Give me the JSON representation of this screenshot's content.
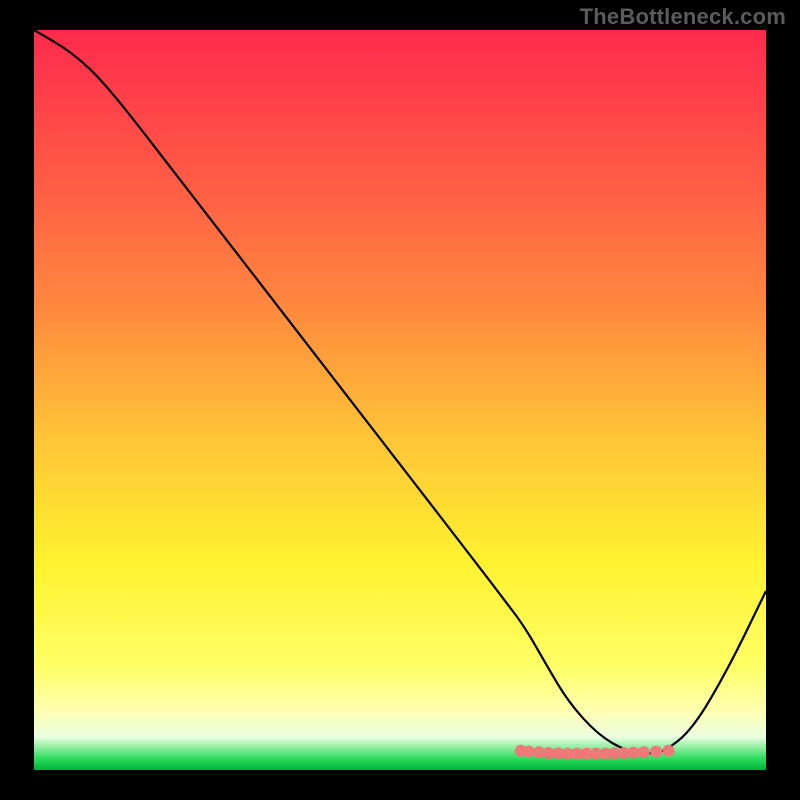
{
  "watermark": "TheBottleneck.com",
  "chart_data": {
    "type": "line",
    "title": "",
    "xlabel": "",
    "ylabel": "",
    "xlim": [
      0,
      100
    ],
    "ylim": [
      0,
      100
    ],
    "gradient_stops": [
      {
        "offset": 0.0,
        "color": "#ff2a4d"
      },
      {
        "offset": 0.2,
        "color": "#ff5a45"
      },
      {
        "offset": 0.38,
        "color": "#ff8a3e"
      },
      {
        "offset": 0.55,
        "color": "#ffc437"
      },
      {
        "offset": 0.72,
        "color": "#fff22f"
      },
      {
        "offset": 0.86,
        "color": "#ffff66"
      },
      {
        "offset": 0.92,
        "color": "#ffffb0"
      },
      {
        "offset": 0.955,
        "color": "#ecffe0"
      },
      {
        "offset": 0.985,
        "color": "#2bdc5d"
      },
      {
        "offset": 1.0,
        "color": "#00b43b"
      }
    ],
    "series": [
      {
        "name": "bottleneck-curve",
        "x": [
          0,
          5.2,
          10,
          20,
          30,
          40,
          50,
          60,
          64,
          67,
          70,
          73,
          77,
          81,
          84,
          86,
          90,
          95,
          100
        ],
        "y": [
          100,
          97,
          92.5,
          79.7,
          66.9,
          54.1,
          41.3,
          28.5,
          23.3,
          19.4,
          14.2,
          9.2,
          4.8,
          2.5,
          2.2,
          2.4,
          5.5,
          14.0,
          24.2
        ],
        "stroke": "#000000",
        "stroke_width": 2.2
      }
    ],
    "markers": {
      "name": "bottom-flat-points",
      "x": [
        66.5,
        67.6,
        69.0,
        70.3,
        71.6,
        72.9,
        74.2,
        75.5,
        76.8,
        78.1,
        79.3,
        80.6,
        81.9,
        83.3,
        85.0,
        86.7
      ],
      "y": [
        2.6,
        2.5,
        2.4,
        2.3,
        2.25,
        2.2,
        2.2,
        2.2,
        2.2,
        2.22,
        2.25,
        2.3,
        2.35,
        2.4,
        2.48,
        2.6
      ],
      "color": "#ef7878",
      "radius": 6
    }
  }
}
